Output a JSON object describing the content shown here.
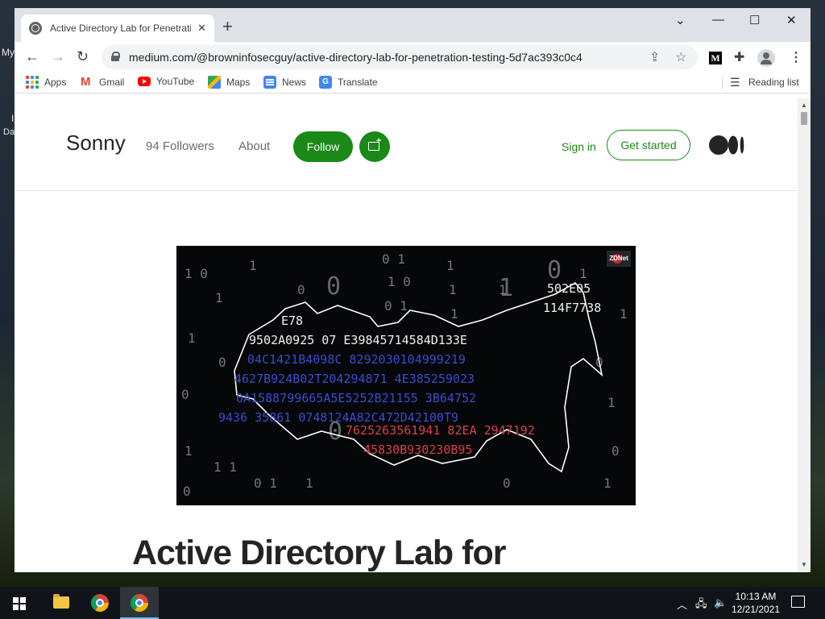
{
  "desktop": {
    "icon_label_1": "My",
    "icon_label_2": "I",
    "icon_label_3": "Da"
  },
  "browser": {
    "tab_title": "Active Directory Lab for Penetration Testing",
    "tab_close": "✕",
    "new_tab": "+",
    "window_controls": {
      "tabs_dropdown": "⌄",
      "minimize": "—",
      "maximize": "☐",
      "close": "✕"
    },
    "url": "medium.com/@browninfosecguy/active-directory-lab-for-penetration-testing-5d7ac393c0c4",
    "nav": {
      "back": "←",
      "forward": "→",
      "reload": "↻"
    },
    "extension_label": "M",
    "bookmarks": [
      {
        "label": "Apps",
        "icon": "apps-icon"
      },
      {
        "label": "Gmail",
        "icon": "gmail-icon"
      },
      {
        "label": "YouTube",
        "icon": "youtube-icon"
      },
      {
        "label": "Maps",
        "icon": "maps-icon"
      },
      {
        "label": "News",
        "icon": "news-icon"
      },
      {
        "label": "Translate",
        "icon": "translate-icon"
      }
    ],
    "reading_list": "Reading list"
  },
  "page": {
    "author": "Sonny",
    "followers": "94 Followers",
    "about": "About",
    "follow_button": "Follow",
    "sign_in": "Sign in",
    "get_started": "Get started",
    "hero_badge": "ZDNet",
    "article_title": "Active Directory Lab for",
    "accent_color": "#1a8917"
  },
  "taskbar": {
    "time": "10:13 AM",
    "date": "12/21/2021"
  }
}
